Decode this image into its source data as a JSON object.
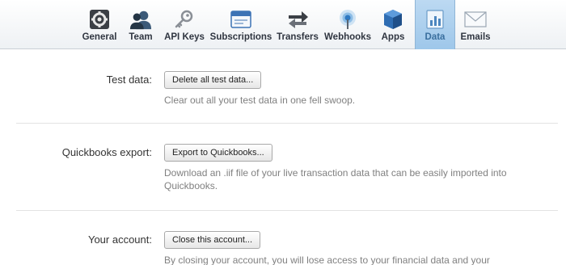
{
  "tabs": [
    {
      "label": "General",
      "icon": "general-gear-icon"
    },
    {
      "label": "Team",
      "icon": "team-people-icon"
    },
    {
      "label": "API Keys",
      "icon": "key-icon"
    },
    {
      "label": "Subscriptions",
      "icon": "subscriptions-window-icon"
    },
    {
      "label": "Transfers",
      "icon": "transfers-arrows-icon"
    },
    {
      "label": "Webhooks",
      "icon": "webhooks-broadcast-icon"
    },
    {
      "label": "Apps",
      "icon": "apps-cube-icon"
    },
    {
      "label": "Data",
      "icon": "data-chart-icon",
      "active": true
    },
    {
      "label": "Emails",
      "icon": "email-envelope-icon"
    }
  ],
  "sections": {
    "test_data": {
      "label": "Test data:",
      "button": "Delete all test data...",
      "description": "Clear out all your test data in one fell swoop."
    },
    "quickbooks": {
      "label": "Quickbooks export:",
      "button": "Export to Quickbooks...",
      "description": "Download an .iif file of your live transaction data that can be easily imported into Quickbooks."
    },
    "account": {
      "label": "Your account:",
      "button": "Close this account...",
      "description": "By closing your account, you will lose access to your financial data and your"
    }
  },
  "colors": {
    "active_tab": "#a9cdee",
    "label_text": "#333333",
    "description_text": "#808080"
  }
}
